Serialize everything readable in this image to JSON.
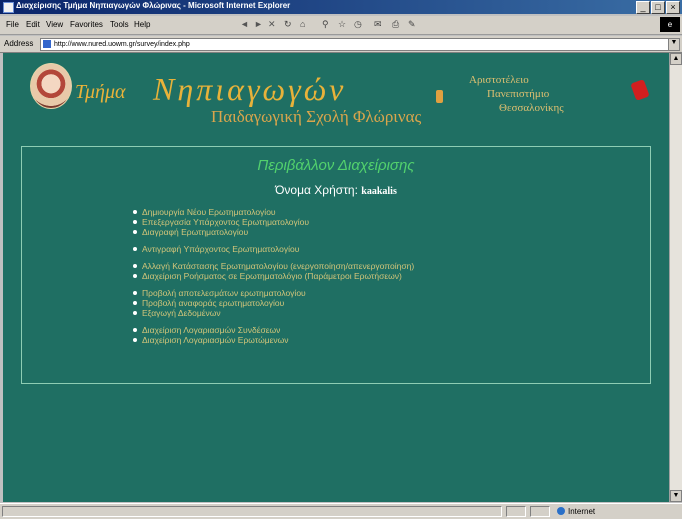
{
  "window": {
    "title": "Διαχείρισης Τμήμα Νηπιαγωγών Φλώρινας - Microsoft Internet Explorer",
    "controls": [
      "_",
      "□",
      "×"
    ]
  },
  "menu": [
    "File",
    "Edit",
    "View",
    "Favorites",
    "Tools",
    "Help"
  ],
  "address": {
    "label": "Address",
    "url": "http://www.nured.uowm.gr/survey/index.php"
  },
  "header": {
    "dept_small": "Τμήμα",
    "dept_big": "Νηπιαγωγών",
    "school": "Παιδαγωγική Σχολή Φλώρινας",
    "university": [
      "Αριστοτέλειο",
      "Πανεπιστήμιο",
      "Θεσσαλονίκης"
    ]
  },
  "panel": {
    "title": "Περιβάλλον Διαχείρισης",
    "username_label": "Όνομα Χρήστη:",
    "username_value": "kaakalis",
    "groups": [
      [
        "Δημιουργία Νέου Ερωτηματολογίου",
        "Επεξεργασία Υπάρχοντος Ερωτηματολογίου",
        "Διαγραφή Ερωτηματολογίου"
      ],
      [
        "Αντιγραφή Υπάρχοντος Ερωτηματολογίου"
      ],
      [
        "Αλλαγή Κατάστασης Ερωτηματολογίου (ενεργοποίηση/απενεργοποίηση)",
        "Διαχείριση Ροήσματος σε Ερωτηματολόγιο (Παράμετροι Ερωτήσεων)"
      ],
      [
        "Προβολή αποτελεσμάτων ερωτηματολογίου",
        "Προβολή αναφοράς ερωτηματολογίου",
        "Εξαγωγή Δεδομένων"
      ],
      [
        "Διαχείριση Λογαριασμών Συνδέσεων",
        "Διαχείριση Λογαριασμών Ερωτώμενων"
      ]
    ]
  },
  "status": {
    "zone": "Internet"
  }
}
